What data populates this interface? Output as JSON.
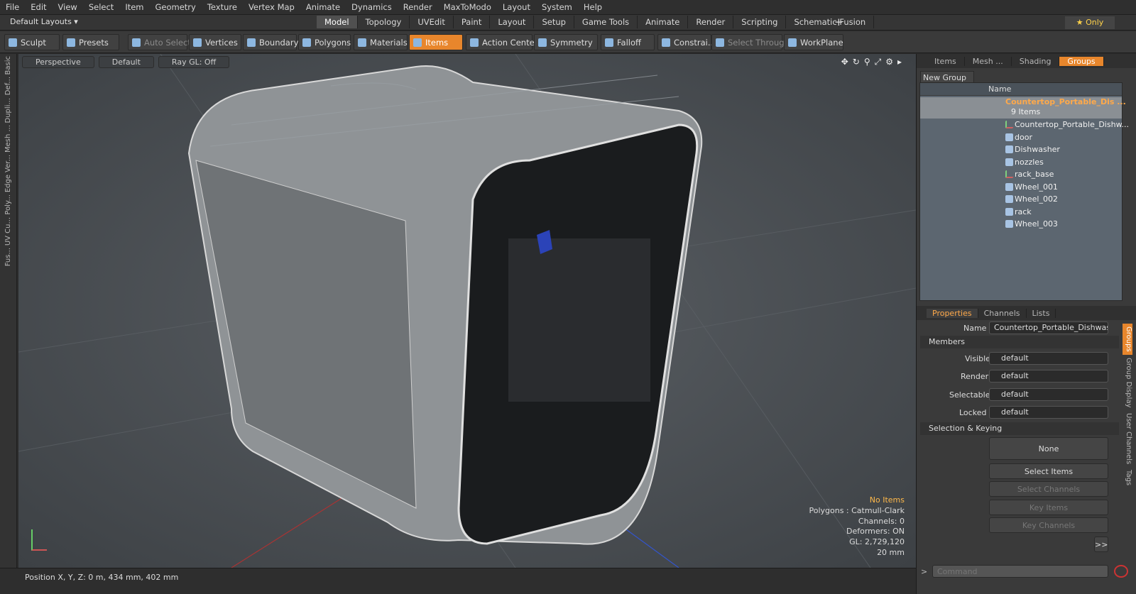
{
  "menu": [
    "File",
    "Edit",
    "View",
    "Select",
    "Item",
    "Geometry",
    "Texture",
    "Vertex Map",
    "Animate",
    "Dynamics",
    "Render",
    "MaxToModo",
    "Layout",
    "System",
    "Help"
  ],
  "layout_selector": "Default Layouts ▾",
  "layout_tabs": [
    "Model",
    "Topology",
    "UVEdit",
    "Paint",
    "Layout",
    "Setup",
    "Game Tools",
    "Animate",
    "Render",
    "Scripting",
    "Schematic Fusion"
  ],
  "only_label": "★  Only",
  "toolbar": {
    "sculpt": "Sculpt",
    "presets": "Presets",
    "auto_select": "Auto Select",
    "vertices": "Vertices",
    "boundary": "Boundary",
    "polygons": "Polygons",
    "materials": "Materials",
    "items": "Items",
    "action_center": "Action Center",
    "symmetry": "Symmetry",
    "falloff": "Falloff",
    "constraints": "Constrai...",
    "select_through": "Select Through",
    "workplane": "WorkPlane"
  },
  "left_tabs": [
    "Basic",
    "Def...",
    "Dupli...",
    "Mesh ...",
    "Ver...",
    "Edge",
    "Poly...",
    "Cu...",
    "UV",
    "Fus..."
  ],
  "viewport": {
    "view": "Perspective",
    "shading": "Default",
    "raygl": "Ray GL: Off"
  },
  "stats": {
    "selection": "No Items",
    "polygons": "Polygons : Catmull-Clark",
    "channels": "Channels: 0",
    "deformers": "Deformers: ON",
    "gl": "GL: 2,729,120",
    "scale": "20 mm"
  },
  "status": {
    "position": "Position X, Y, Z:   0 m, 434 mm, 402 mm"
  },
  "right_tabs": [
    "Items",
    "Mesh ...",
    "Shading",
    "Groups"
  ],
  "new_group": "New Group",
  "tree_header": "Name",
  "tree": {
    "root": "Countertop_Portable_Dis ...",
    "count": "9 Items",
    "items": [
      "Countertop_Portable_Dishw...",
      "door",
      "Dishwasher",
      "nozzles",
      "rack_base",
      "Wheel_001",
      "Wheel_002",
      "rack",
      "Wheel_003"
    ]
  },
  "prop_tabs": [
    "Properties",
    "Channels",
    "Lists"
  ],
  "props": {
    "name_label": "Name",
    "name_value": "Countertop_Portable_Dishwasher",
    "members": "Members",
    "visible": "Visible",
    "render": "Render",
    "selectable": "Selectable",
    "locked": "Locked",
    "default": "default",
    "selection_keying": "Selection & Keying",
    "none": "None",
    "select_items": "Select Items",
    "select_channels": "Select Channels",
    "key_items": "Key Items",
    "key_channels": "Key Channels",
    "more": ">>"
  },
  "vertical_tabs": [
    "Groups",
    "Group Display",
    "User Channels",
    "Tags"
  ],
  "command_placeholder": "Command"
}
